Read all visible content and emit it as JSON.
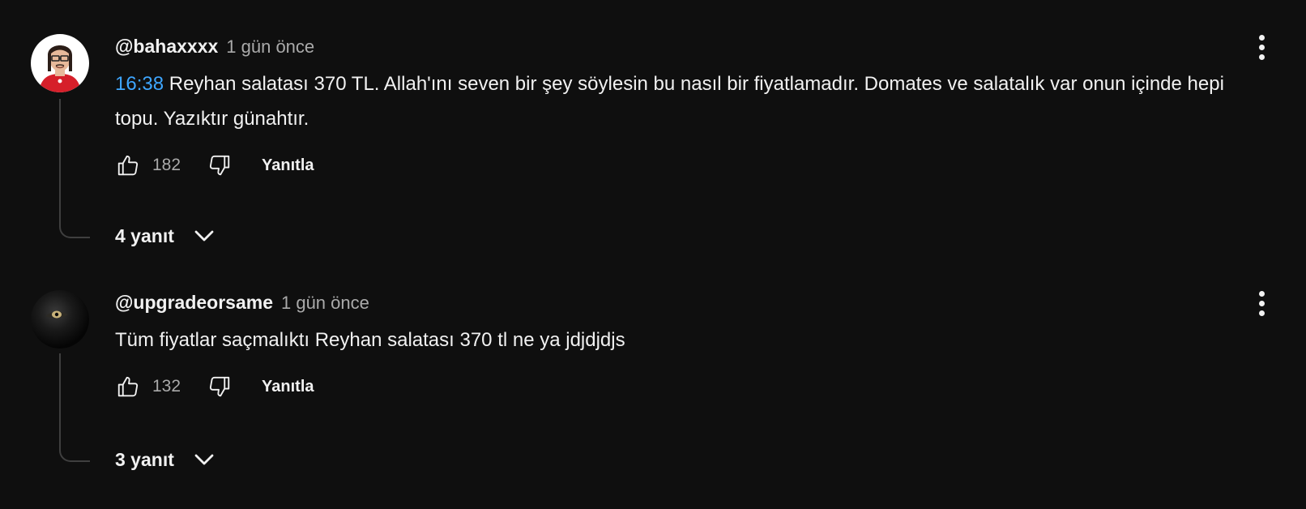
{
  "comments": [
    {
      "author": "@bahaxxxx",
      "date": "1 gün önce",
      "timestamp": "16:38",
      "text": " Reyhan salatası 370 TL. Allah'ını seven bir şey söylesin bu nasıl bir fiyatlamadır. Domates ve salatalık var onun içinde hepi topu. Yazıktır günahtır.",
      "likes": "182",
      "reply_label": "Yanıtla",
      "replies_label": "4 yanıt",
      "avatar_icon": "cartoon-avatar-icon"
    },
    {
      "author": "@upgradeorsame",
      "date": "1 gün önce",
      "timestamp": "",
      "text": "Tüm fiyatlar saçmalıktı Reyhan salatası 370 tl ne ya jdjdjdjs",
      "likes": "132",
      "reply_label": "Yanıtla",
      "replies_label": "3 yanıt",
      "avatar_icon": "dark-eye-avatar-icon"
    }
  ],
  "colors": {
    "background": "#0f0f0f",
    "text": "#f1f1f1",
    "muted": "#aaaaaa",
    "link": "#3ea6ff",
    "thread_line": "#3f3f3f"
  }
}
